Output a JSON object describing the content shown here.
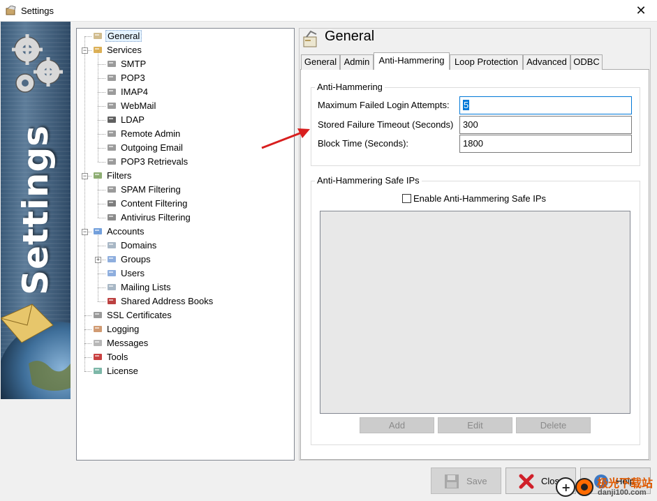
{
  "window": {
    "title": "Settings",
    "close_glyph": "✕"
  },
  "banner": {
    "text": "Settings"
  },
  "tree": {
    "items": [
      {
        "label": "General",
        "icon": "general-icon"
      },
      {
        "label": "Services",
        "icon": "services-icon",
        "expander": "−"
      },
      {
        "label": "SMTP",
        "icon": "smtp-icon"
      },
      {
        "label": "POP3",
        "icon": "pop3-icon"
      },
      {
        "label": "IMAP4",
        "icon": "imap4-icon"
      },
      {
        "label": "WebMail",
        "icon": "webmail-icon"
      },
      {
        "label": "LDAP",
        "icon": "ldap-icon"
      },
      {
        "label": "Remote Admin",
        "icon": "remote-admin-icon"
      },
      {
        "label": "Outgoing Email",
        "icon": "outgoing-email-icon"
      },
      {
        "label": "POP3 Retrievals",
        "icon": "pop3-retrievals-icon"
      },
      {
        "label": "Filters",
        "icon": "filters-icon",
        "expander": "−"
      },
      {
        "label": "SPAM Filtering",
        "icon": "spam-filtering-icon"
      },
      {
        "label": "Content Filtering",
        "icon": "content-filtering-icon"
      },
      {
        "label": "Antivirus Filtering",
        "icon": "antivirus-filtering-icon"
      },
      {
        "label": "Accounts",
        "icon": "accounts-folder-icon",
        "expander": "−"
      },
      {
        "label": "Domains",
        "icon": "domains-icon"
      },
      {
        "label": "Groups",
        "icon": "groups-icon",
        "expander": "+"
      },
      {
        "label": "Users",
        "icon": "users-icon"
      },
      {
        "label": "Mailing Lists",
        "icon": "mailing-lists-icon"
      },
      {
        "label": "Shared Address Books",
        "icon": "address-books-icon"
      },
      {
        "label": "SSL Certificates",
        "icon": "ssl-certificates-icon"
      },
      {
        "label": "Logging",
        "icon": "logging-icon"
      },
      {
        "label": "Messages",
        "icon": "messages-icon"
      },
      {
        "label": "Tools",
        "icon": "tools-icon"
      },
      {
        "label": "License",
        "icon": "license-icon"
      }
    ]
  },
  "panel": {
    "title": "General",
    "tabs": [
      "General",
      "Admin",
      "Anti-Hammering",
      "Loop Protection",
      "Advanced",
      "ODBC"
    ],
    "active_tab": "Anti-Hammering"
  },
  "anti_hammering": {
    "legend": "Anti-Hammering",
    "max_failed_label": "Maximum Failed Login Attempts:",
    "max_failed_value": "5",
    "stored_timeout_label": "Stored Failure Timeout (Seconds)",
    "stored_timeout_value": "300",
    "block_time_label": "Block Time (Seconds):",
    "block_time_value": "1800"
  },
  "safe_ips": {
    "legend": "Anti-Hammering Safe IPs",
    "enable_label": "Enable Anti-Hammering Safe IPs",
    "add_label": "Add",
    "edit_label": "Edit",
    "delete_label": "Delete"
  },
  "footer": {
    "save_label": "Save",
    "close_label": "Close",
    "help_label": "Help"
  },
  "watermark": {
    "text1": "极光下载站",
    "text2": "danji100.com"
  },
  "colors": {
    "accent": "#0078d7",
    "annotation_arrow": "#d81e1e"
  }
}
